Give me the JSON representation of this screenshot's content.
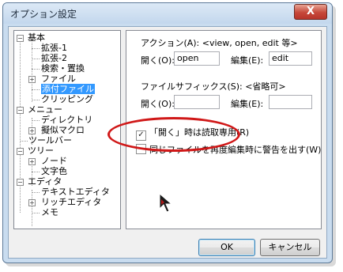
{
  "window": {
    "title": "オプション設定",
    "close_symbol": "X"
  },
  "tree": {
    "items": [
      {
        "label": "基本",
        "expander": "−"
      },
      {
        "label": "拡張-1"
      },
      {
        "label": "拡張-2"
      },
      {
        "label": "検索・置換"
      },
      {
        "label": "ファイル",
        "expander": "+"
      },
      {
        "label": "添付ファイル",
        "selected": true
      },
      {
        "label": "クリッピング"
      },
      {
        "label": "メニュー",
        "expander": "−"
      },
      {
        "label": "ディレクトリ"
      },
      {
        "label": "擬似マクロ",
        "expander": "+"
      },
      {
        "label": "ツールバー"
      },
      {
        "label": "ツリー",
        "expander": "−"
      },
      {
        "label": "ノード",
        "expander": "+"
      },
      {
        "label": "文字色"
      },
      {
        "label": "エディタ",
        "expander": "−"
      },
      {
        "label": "テキストエディタ"
      },
      {
        "label": "リッチエディタ",
        "expander": "+"
      },
      {
        "label": "メモ"
      }
    ]
  },
  "panel": {
    "action": {
      "label": "アクション(A): <view, open, edit 等>",
      "open_label": "開く(O):",
      "open_value": "open",
      "edit_label": "編集(E):",
      "edit_value": "edit"
    },
    "suffix": {
      "label": "ファイルサフィックス(S): <省略可>",
      "open_label": "開く(O):",
      "open_value": "",
      "edit_label": "編集(E):",
      "edit_value": ""
    },
    "checkboxes": [
      {
        "label": "「開く」時は読取専用(R)",
        "checked": true,
        "mark": "✓"
      },
      {
        "label": "同じファイルを再度編集時に警告を出す(W)",
        "checked": false,
        "mark": ""
      }
    ]
  },
  "buttons": {
    "ok": "OK",
    "cancel": "キャンセル"
  },
  "colors": {
    "selection": "#3399ff",
    "annotation": "#d01818",
    "close_button": "#c6483a"
  },
  "icons": [
    "close-icon",
    "mouse-cursor-icon"
  ]
}
